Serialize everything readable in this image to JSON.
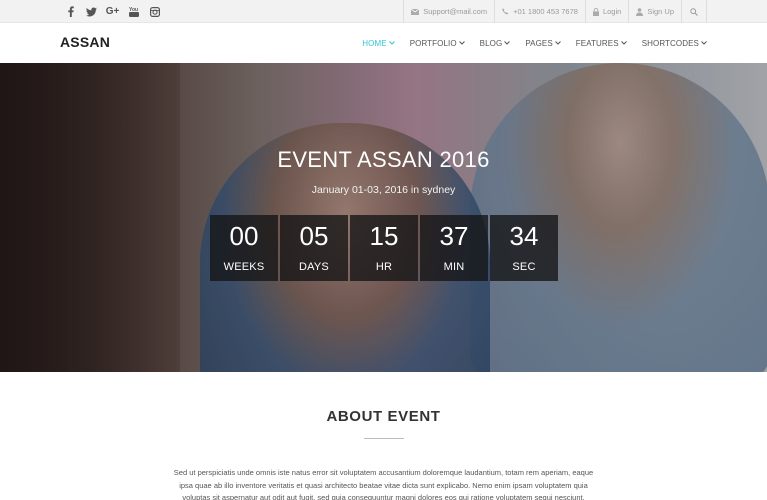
{
  "topbar": {
    "social": [
      "facebook-icon",
      "twitter-icon",
      "google-plus-icon",
      "youtube-icon",
      "instagram-icon"
    ],
    "social_labels": {
      "google_plus": "G+",
      "youtube": "You"
    },
    "email": "Support@mail.com",
    "phone": "+01 1800 453 7678",
    "login": "Login",
    "signup": "Sign Up"
  },
  "nav": {
    "logo": "ASSAN",
    "items": [
      {
        "label": "HOME",
        "active": true
      },
      {
        "label": "PORTFOLIO",
        "active": false
      },
      {
        "label": "BLOG",
        "active": false
      },
      {
        "label": "PAGES",
        "active": false
      },
      {
        "label": "FEATURES",
        "active": false
      },
      {
        "label": "SHORTCODES",
        "active": false
      }
    ],
    "accent": "#32c5d2"
  },
  "hero": {
    "title": "EVENT ASSAN 2016",
    "subtitle": "January 01-03, 2016 in sydney",
    "countdown": [
      {
        "value": "00",
        "label": "WEEKS"
      },
      {
        "value": "05",
        "label": "DAYS"
      },
      {
        "value": "15",
        "label": "HR"
      },
      {
        "value": "37",
        "label": "MIN"
      },
      {
        "value": "34",
        "label": "SEC"
      }
    ]
  },
  "about": {
    "title": "ABOUT EVENT",
    "text": "Sed ut perspiciatis unde omnis iste natus error sit voluptatem accusantium doloremque laudantium, totam rem aperiam, eaque ipsa quae ab illo inventore veritatis et quasi architecto beatae vitae dicta sunt explicabo. Nemo enim ipsam voluptatem quia voluptas sit aspernatur aut odit aut fugit, sed quia consequuntur magni dolores eos qui ratione voluptatem sequi nesciunt."
  }
}
